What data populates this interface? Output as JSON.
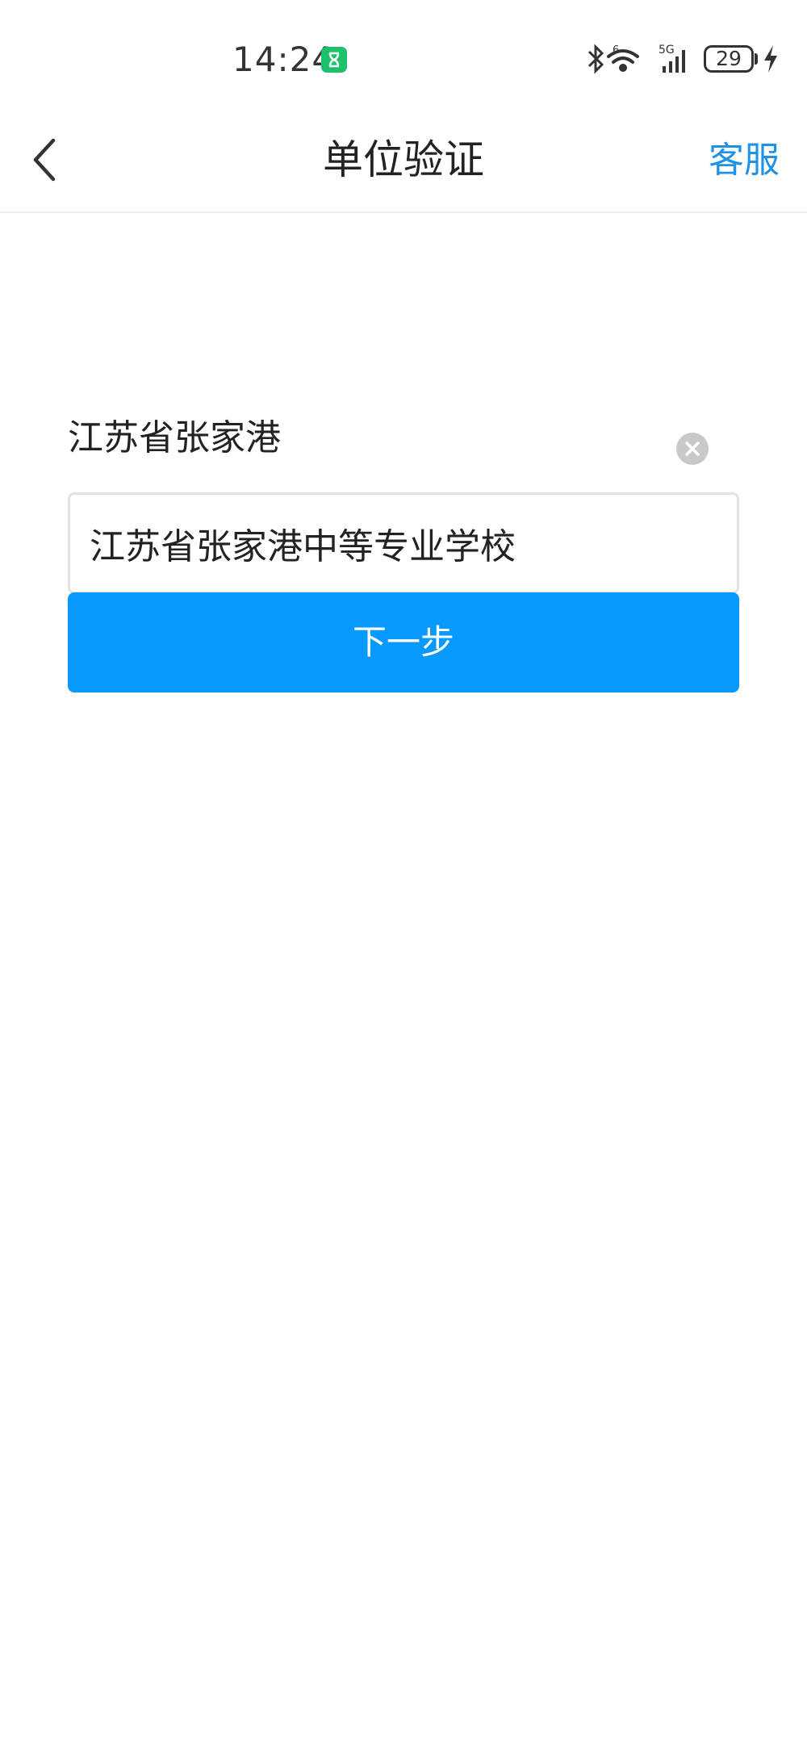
{
  "status_bar": {
    "time": "14:24",
    "battery_level": "29",
    "network_label": "5G",
    "wifi_generation": "6",
    "icons": [
      "hourglass-icon",
      "bluetooth-icon",
      "wifi-icon",
      "cellular-signal-icon",
      "battery-icon",
      "charging-icon"
    ]
  },
  "nav": {
    "title": "单位验证",
    "right_link": "客服",
    "back_icon": "chevron-left-icon"
  },
  "form": {
    "region_label": "江苏省张家港",
    "school_value": "江苏省张家港中等专业学校",
    "clear_icon": "clear-icon",
    "next_label": "下一步"
  },
  "colors": {
    "accent": "#0899ff",
    "link": "#1e92e5",
    "hourglass_badge": "#1ec16b",
    "clear_button": "#c9c9c9"
  }
}
